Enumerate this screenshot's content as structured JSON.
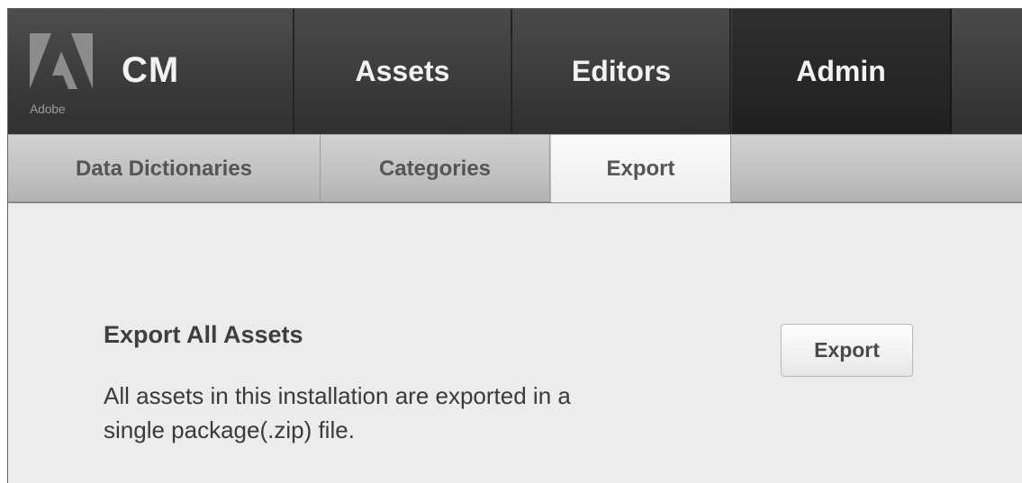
{
  "brand": {
    "logo_text": "Adobe",
    "app_name": "CM"
  },
  "main_nav": {
    "tabs": [
      {
        "label": "Assets",
        "active": false
      },
      {
        "label": "Editors",
        "active": false
      },
      {
        "label": "Admin",
        "active": true
      }
    ]
  },
  "sub_nav": {
    "tabs": [
      {
        "label": "Data Dictionaries",
        "active": false
      },
      {
        "label": "Categories",
        "active": false
      },
      {
        "label": "Export",
        "active": true
      }
    ]
  },
  "content": {
    "section_title": "Export All Assets",
    "description_line1": "All assets in this installation are exported in a",
    "description_line2": "single package(.zip) file.",
    "export_button_label": "Export"
  },
  "colors": {
    "topbar": "#3c3c3c",
    "active_top_tab": "#262626",
    "subbar": "#c2c2c2",
    "active_sub_tab": "#f4f4f4",
    "content_bg": "#ececec"
  },
  "icons": {
    "brand_logo": "adobe-logo-icon"
  }
}
